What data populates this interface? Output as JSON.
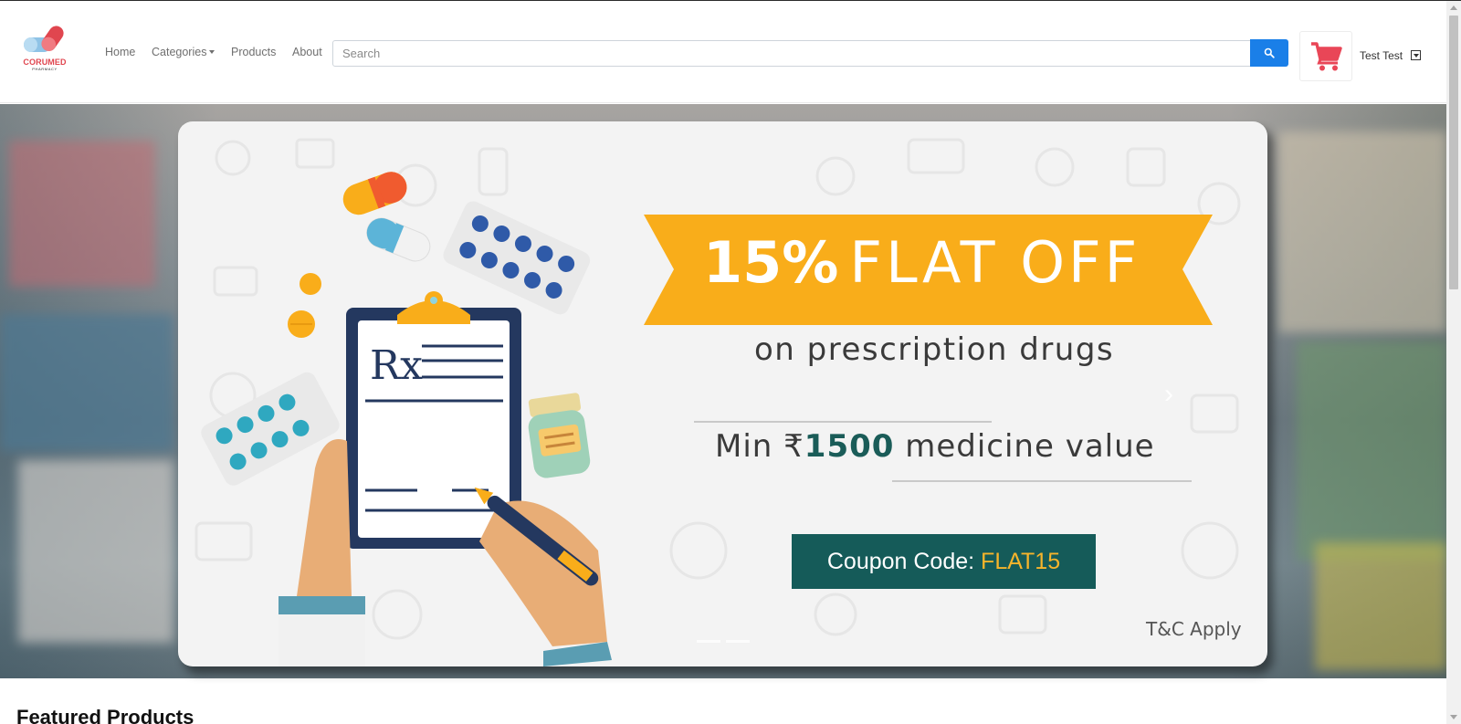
{
  "brand": {
    "name": "CORUMED",
    "tagline": "PHARMACY"
  },
  "nav": {
    "home": "Home",
    "categories": "Categories",
    "products": "Products",
    "about": "About"
  },
  "search": {
    "placeholder": "Search",
    "value": ""
  },
  "user": {
    "name": "Test Test"
  },
  "banner": {
    "percent": "15%",
    "flat_off": "FLAT OFF",
    "subtitle": "on prescription drugs",
    "min_prefix": "Min ₹",
    "min_amount": "1500",
    "min_suffix": " medicine value",
    "coupon_label": "Coupon Code: ",
    "coupon_code": "FLAT15",
    "terms": "T&C Apply",
    "rx_symbol": "Rx",
    "slides_count": 2,
    "active_slide": 1
  },
  "section": {
    "featured_title": "Featured Products"
  },
  "colors": {
    "accent_blue": "#1a7fe8",
    "cart_red": "#e94657",
    "ribbon_orange": "#f9ad1a",
    "coupon_teal": "#155b59",
    "coupon_code_yellow": "#f6b42b"
  },
  "icons": {
    "search": "search-icon",
    "cart": "shopping-cart-icon",
    "dropdown": "chevron-down-icon",
    "next": "chevron-right-icon"
  }
}
